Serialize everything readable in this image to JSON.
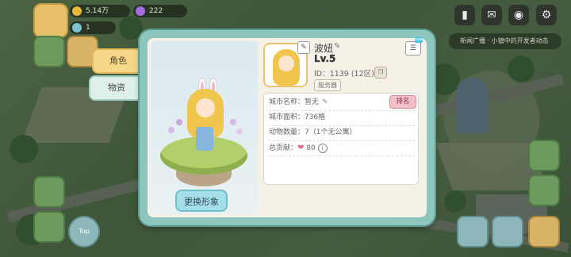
{
  "hud": {
    "gold_amount": "5.14万",
    "gem_amount": "222",
    "ticket_amount": "1"
  },
  "notice_text": "新闻广播 · 小镇中的开发者动态",
  "tabs": [
    {
      "label": "角色",
      "active": true
    },
    {
      "label": "物资",
      "active": false
    }
  ],
  "character": {
    "change_button": "更换形象"
  },
  "profile": {
    "name": "波妞",
    "level": "Lv.5",
    "id_label": "ID：1139 (12区)",
    "server_tag": "服务器",
    "new_badge": "new"
  },
  "stats": {
    "city_name_label": "城市名称：",
    "city_name_value": "暂无",
    "rank_button": "排名",
    "city_area": "城市面积：736格",
    "animal_count": "动物数量：7（1个无公寓）",
    "contribution_label": "总贡献：",
    "contribution_value": "80"
  },
  "side_label": "Top",
  "colors": {
    "dialog_border": "#8cc6bd",
    "active_tab": "#f7d88a",
    "rank_button": "#f4c0c8",
    "change_button": "#a4dfe9"
  }
}
